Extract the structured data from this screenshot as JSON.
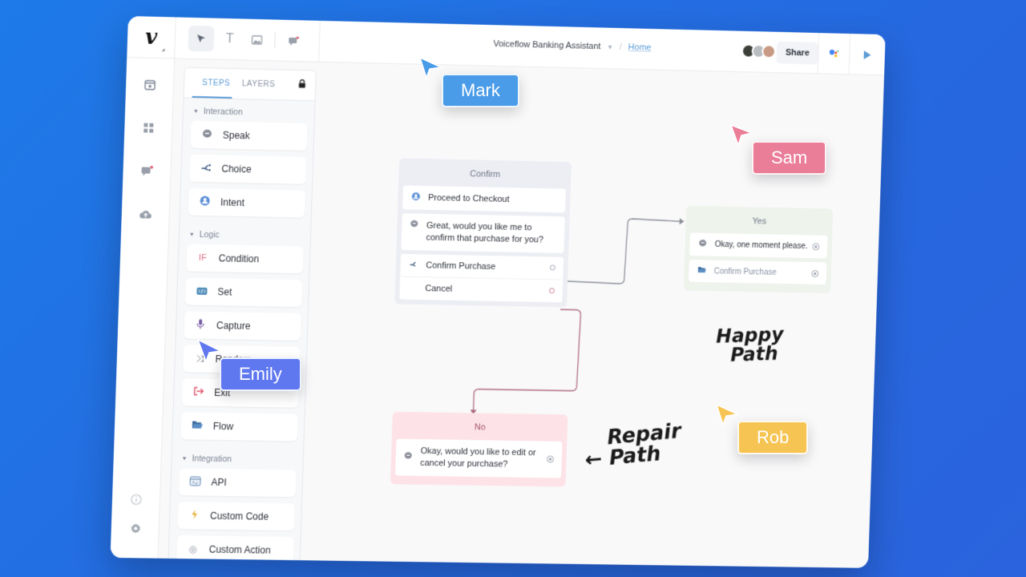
{
  "app": {
    "logo": "v",
    "project_title": "Voiceflow Banking Assistant",
    "breadcrumb_page": "Home",
    "share_label": "Share"
  },
  "toolbar": {
    "tools": [
      "select-tool",
      "text-tool",
      "image-tool",
      "comment-tool"
    ]
  },
  "rail": {
    "icons": [
      "add-flow-icon",
      "grid-icon",
      "comments-icon",
      "upload-icon",
      "info-icon",
      "settings-icon"
    ]
  },
  "panel": {
    "tabs": [
      {
        "label": "STEPS",
        "active": true
      },
      {
        "label": "LAYERS",
        "active": false
      }
    ],
    "sections": [
      {
        "label": "Interaction",
        "items": [
          {
            "label": "Speak",
            "icon": "speak-icon"
          },
          {
            "label": "Choice",
            "icon": "choice-icon"
          },
          {
            "label": "Intent",
            "icon": "intent-icon"
          }
        ]
      },
      {
        "label": "Logic",
        "items": [
          {
            "label": "Condition",
            "icon": "if-icon"
          },
          {
            "label": "Set",
            "icon": "code-icon"
          },
          {
            "label": "Capture",
            "icon": "mic-icon"
          },
          {
            "label": "Random",
            "icon": "random-icon"
          },
          {
            "label": "Exit",
            "icon": "exit-icon"
          },
          {
            "label": "Flow",
            "icon": "folder-icon"
          }
        ]
      },
      {
        "label": "Integration",
        "items": [
          {
            "label": "API",
            "icon": "api-icon"
          },
          {
            "label": "Custom Code",
            "icon": "bolt-icon"
          },
          {
            "label": "Custom Action",
            "icon": "target-icon"
          }
        ]
      }
    ]
  },
  "canvas": {
    "confirm_block": {
      "title": "Confirm",
      "rows": [
        {
          "text": "Proceed to Checkout",
          "icon": "intent-icon"
        },
        {
          "text": "Great, would you like me to confirm that purchase for you?",
          "icon": "speak-icon"
        },
        {
          "text": "Confirm Purchase",
          "icon": "choice-icon"
        },
        {
          "text": "Cancel",
          "icon": ""
        }
      ]
    },
    "yes_block": {
      "title": "Yes",
      "rows": [
        {
          "text": "Okay, one moment please.",
          "icon": "speak-icon"
        },
        {
          "text": "Confirm Purchase",
          "icon": "folder-icon"
        }
      ]
    },
    "no_block": {
      "title": "No",
      "rows": [
        {
          "text": "Okay, would you like to edit or cancel your purchase?",
          "icon": "speak-icon"
        }
      ]
    },
    "annotations": {
      "happy_line1": "Happy",
      "happy_line2": "Path",
      "repair_line1": "Repair",
      "repair_line2": "← Path"
    }
  },
  "collaborators": [
    {
      "name": "Mark",
      "color": "#4a9be8"
    },
    {
      "name": "Sam",
      "color": "#ea7d97"
    },
    {
      "name": "Emily",
      "color": "#5f78f0"
    },
    {
      "name": "Rob",
      "color": "#f6c453"
    }
  ],
  "colors": {
    "background": "#2568e0",
    "accent": "#5b9bd5",
    "yes_block": "#eef3ec",
    "no_block": "#fde3e8",
    "confirm_block": "#eceef4"
  }
}
